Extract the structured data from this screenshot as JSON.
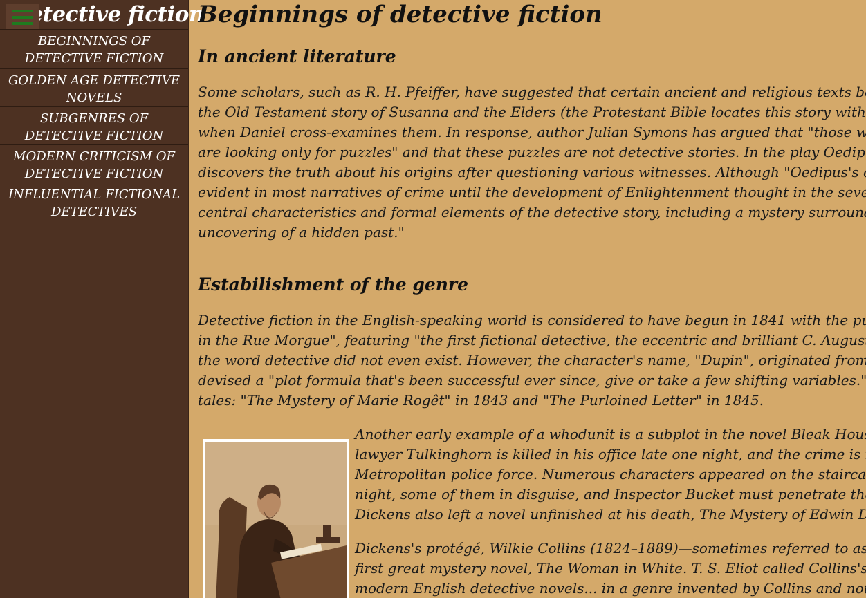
{
  "sidebar": {
    "site_title": "Detective fiction",
    "menu_icon": "hamburger-menu-icon",
    "nav": [
      "BEGINNINGS OF DETECTIVE FICTION",
      "GOLDEN AGE DETECTIVE NOVELS",
      "SUBGENRES OF DETECTIVE FICTION",
      "MODERN CRITICISM OF DETECTIVE FICTION",
      "INFLUENTIAL FICTIONAL DETECTIVES"
    ],
    "nav_lines": [
      [
        "BEGINNINGS OF",
        "DETECTIVE FICTION"
      ],
      [
        "GOLDEN AGE DETECTIVE",
        "NOVELS"
      ],
      [
        "SUBGENRES OF",
        "DETECTIVE FICTION"
      ],
      [
        "MODERN CRITICISM OF",
        "DETECTIVE FICTION"
      ],
      [
        "INFLUENTIAL FICTIONAL",
        "DETECTIVES"
      ]
    ]
  },
  "main": {
    "title": "Beginnings of detective fiction",
    "section1": {
      "heading": "In ancient literature",
      "lines": [
        "Some scholars, such as R. H. Pfeiffer, have suggested that certain ancient and religious texts bear",
        "the Old Testament story of Susanna and the Elders (the Protestant Bible locates this story within t",
        "when Daniel cross-examines them. In response, author Julian Symons has argued that \"those who",
        "are looking only for puzzles\" and that these puzzles are not detective stories. In the play Oedipus",
        "discovers the truth about his origins after questioning various witnesses. Although \"Oedipus's eng",
        "evident in most narratives of crime until the development of Enlightenment thought in the sevente",
        "central characteristics and formal elements of the detective story, including a mystery surroundin",
        "uncovering of a hidden past.\""
      ]
    },
    "section2": {
      "heading": "Estabilishment of the genre",
      "lines": [
        "Detective fiction in the English-speaking world is considered to have begun in 1841 with the publi",
        "in the Rue Morgue\", featuring \"the first fictional detective, the eccentric and brilliant C. Auguste D",
        "the word detective did not even exist. However, the character's name, \"Dupin\", originated from the",
        "devised a \"plot formula that's been successful ever since, give or take a few shifting variables.\"Poe",
        "tales: \"The Mystery of Marie Rogêt\" in 1843 and \"The Purloined Letter\" in 1845."
      ],
      "para2_lines": [
        "Another early example of a whodunit is a subplot in the novel Bleak House",
        "lawyer Tulkinghorn is killed in his office late one night, and the crime is inv",
        "Metropolitan police force. Numerous characters appeared on the staircase",
        "night, some of them in disguise, and Inspector Bucket must penetrate these",
        "Dickens also left a novel unfinished at his death, The Mystery of Edwin Dro"
      ],
      "para3_lines": [
        "Dickens's protégé, Wilkie Collins (1824–1889)—sometimes referred to as the",
        "first great mystery novel, The Woman in White. T. S. Eliot called Collins's nov",
        "modern English detective novels... in a genre invented by Collins and not by"
      ]
    }
  }
}
